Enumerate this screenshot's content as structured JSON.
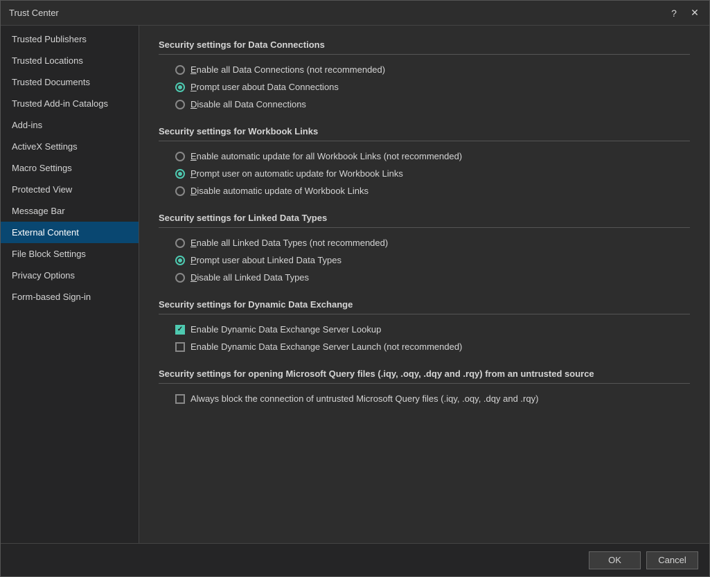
{
  "titleBar": {
    "title": "Trust Center",
    "helpBtn": "?",
    "closeBtn": "✕"
  },
  "sidebar": {
    "items": [
      {
        "id": "trusted-publishers",
        "label": "Trusted Publishers",
        "active": false
      },
      {
        "id": "trusted-locations",
        "label": "Trusted Locations",
        "active": false
      },
      {
        "id": "trusted-documents",
        "label": "Trusted Documents",
        "active": false
      },
      {
        "id": "trusted-addins",
        "label": "Trusted Add-in Catalogs",
        "active": false
      },
      {
        "id": "addins",
        "label": "Add-ins",
        "active": false
      },
      {
        "id": "activex",
        "label": "ActiveX Settings",
        "active": false
      },
      {
        "id": "macro",
        "label": "Macro Settings",
        "active": false
      },
      {
        "id": "protected-view",
        "label": "Protected View",
        "active": false
      },
      {
        "id": "message-bar",
        "label": "Message Bar",
        "active": false
      },
      {
        "id": "external-content",
        "label": "External Content",
        "active": true
      },
      {
        "id": "file-block",
        "label": "File Block Settings",
        "active": false
      },
      {
        "id": "privacy",
        "label": "Privacy Options",
        "active": false
      },
      {
        "id": "form-signin",
        "label": "Form-based Sign-in",
        "active": false
      }
    ]
  },
  "content": {
    "sections": [
      {
        "id": "data-connections",
        "title": "Security settings for Data Connections",
        "type": "radio",
        "options": [
          {
            "id": "dc-enable",
            "label": "Enable all Data Connections (not recommended)",
            "checked": false,
            "underlineChar": "E"
          },
          {
            "id": "dc-prompt",
            "label": "Prompt user about Data Connections",
            "checked": true,
            "underlineChar": "P"
          },
          {
            "id": "dc-disable",
            "label": "Disable all Data Connections",
            "checked": false,
            "underlineChar": "D"
          }
        ]
      },
      {
        "id": "workbook-links",
        "title": "Security settings for Workbook Links",
        "type": "radio",
        "options": [
          {
            "id": "wl-enable",
            "label": "Enable automatic update for all Workbook Links (not recommended)",
            "checked": false,
            "underlineChar": "E"
          },
          {
            "id": "wl-prompt",
            "label": "Prompt user on automatic update for Workbook Links",
            "checked": true,
            "underlineChar": "P"
          },
          {
            "id": "wl-disable",
            "label": "Disable automatic update of Workbook Links",
            "checked": false,
            "underlineChar": "D"
          }
        ]
      },
      {
        "id": "linked-data-types",
        "title": "Security settings for Linked Data Types",
        "type": "radio",
        "options": [
          {
            "id": "ldt-enable",
            "label": "Enable all Linked Data Types (not recommended)",
            "checked": false,
            "underlineChar": "E"
          },
          {
            "id": "ldt-prompt",
            "label": "Prompt user about Linked Data Types",
            "checked": true,
            "underlineChar": "P"
          },
          {
            "id": "ldt-disable",
            "label": "Disable all Linked Data Types",
            "checked": false,
            "underlineChar": "D"
          }
        ]
      },
      {
        "id": "dynamic-data-exchange",
        "title": "Security settings for Dynamic Data Exchange",
        "type": "checkbox",
        "options": [
          {
            "id": "dde-lookup",
            "label": "Enable Dynamic Data Exchange Server Lookup",
            "checked": true
          },
          {
            "id": "dde-launch",
            "label": "Enable Dynamic Data Exchange Server Launch (not recommended)",
            "checked": false
          }
        ]
      },
      {
        "id": "microsoft-query",
        "title": "Security settings for opening  Microsoft Query files (.iqy, .oqy, .dqy and .rqy) from an untrusted source",
        "type": "checkbox",
        "options": [
          {
            "id": "mq-block",
            "label": "Always block the connection of untrusted Microsoft Query files (.iqy, .oqy, .dqy and .rqy)",
            "checked": false
          }
        ]
      }
    ]
  },
  "footer": {
    "ok_label": "OK",
    "cancel_label": "Cancel"
  }
}
